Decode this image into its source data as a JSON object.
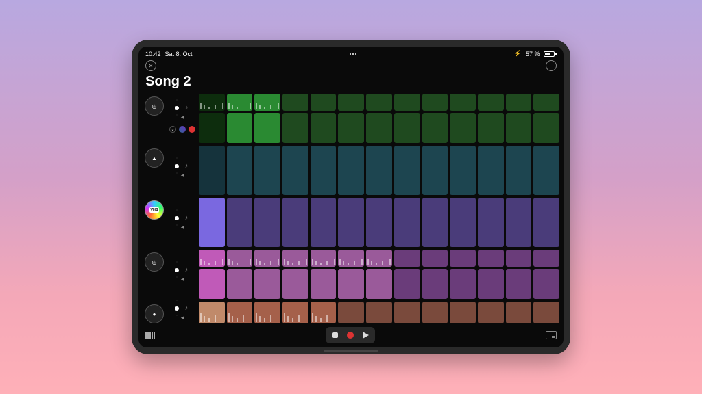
{
  "status": {
    "time": "10:42",
    "date": "Sat 8. Oct",
    "battery_pct": "57 %",
    "charging_glyph": "⚡"
  },
  "song": {
    "title": "Song 2"
  },
  "tracks": [
    {
      "instrument": "synth-1",
      "color_empty": "#1f4a1f",
      "color_first": "#0d2d0d",
      "color_pattern": "#2a8a32",
      "has_subrow": true,
      "patterns": [
        1,
        2
      ]
    },
    {
      "instrument": "lead",
      "color_empty": "#1d4550",
      "color_first": "#15333c",
      "color_pattern": "#2a7d90",
      "has_subrow": false,
      "patterns": [
        0
      ]
    },
    {
      "instrument": "vhs",
      "color_empty": "#4a3c7a",
      "color_first": "#7a68e0",
      "color_pattern": "#8a78f0",
      "has_subrow": false,
      "patterns": [
        0
      ]
    },
    {
      "instrument": "synth-2",
      "color_empty": "#6a3c7a",
      "color_first": "#c05ab8",
      "color_pattern": "#9a5a9a",
      "has_subrow": true,
      "patterns": [
        0,
        1,
        2,
        3,
        4,
        5,
        6
      ]
    },
    {
      "instrument": "drums",
      "color_empty": "#7a4a3c",
      "color_first": "#c08a6a",
      "color_pattern": "#a5604a",
      "has_subrow": false,
      "short": true,
      "patterns": [
        0,
        1,
        2,
        3,
        4
      ]
    }
  ],
  "clip_columns": 13
}
